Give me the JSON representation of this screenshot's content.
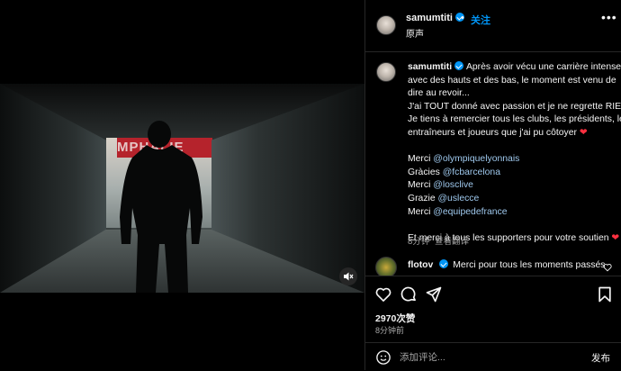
{
  "video": {
    "sign_text": "MPHALIE"
  },
  "header": {
    "username": "samumtiti",
    "follow_label": "关注",
    "audio_label": "原声",
    "more_icon": "more-horizontal-icon"
  },
  "caption": {
    "username": "samumtiti",
    "lines": [
      "Après avoir vécu une carrière intense",
      "avec des hauts et des bas, le moment est venu de",
      "dire au revoir...",
      "J'ai TOUT donné avec passion et je ne regrette RIEN.",
      "Je tiens à remercier tous les clubs, les présidents, les",
      "entraîneurs et joueurs que j'ai pu côtoyer"
    ],
    "thanks": [
      {
        "word": "Merci",
        "mention": "@olympiquelyonnais"
      },
      {
        "word": "Gràcies",
        "mention": "@fcbarcelona"
      },
      {
        "word": "Merci",
        "mention": "@losclive"
      },
      {
        "word": "Grazie",
        "mention": "@uslecce"
      },
      {
        "word": "Merci",
        "mention": "@equipedefrance"
      }
    ],
    "closing": "Et merci à tous les supporters pour votre soutien",
    "time_ago": "8分钟",
    "see_translation": "查看翻译"
  },
  "comment": {
    "username": "flotov",
    "text": "Merci pour tous les moments passés"
  },
  "actions": {
    "likes": "2970次赞",
    "time": "8分钟前"
  },
  "comment_box": {
    "placeholder": "添加评论...",
    "post_label": "发布"
  },
  "colors": {
    "accent": "#0095f6",
    "heart": "#ff3040",
    "muted": "#a8a8a8"
  }
}
